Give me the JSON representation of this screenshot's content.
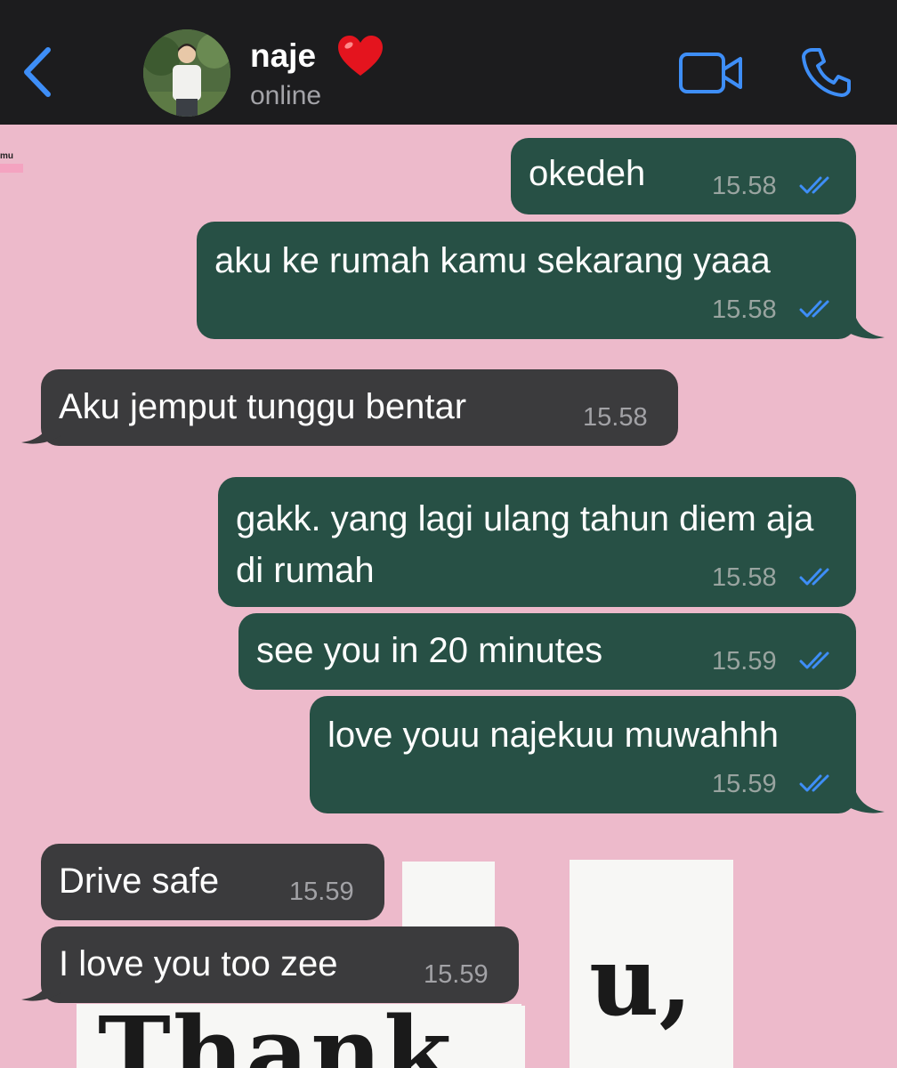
{
  "colors": {
    "outgoing_bubble": "#275045",
    "incoming_bubble": "#3b3b3d",
    "header_bg": "#1c1c1e",
    "wallpaper": "#edbacb",
    "accent": "#3e8ef7"
  },
  "header": {
    "name": "naje",
    "heart": "❤️",
    "status": "online",
    "icons": [
      "back-chevron-icon",
      "video-call-icon",
      "phone-call-icon"
    ]
  },
  "wallpaper": {
    "sticker_text": "mu",
    "deco_text": "Thank",
    "deco_u": "u,"
  },
  "messages": [
    {
      "direction": "out",
      "text": "okedeh",
      "time": "15.58",
      "read": true
    },
    {
      "direction": "out",
      "text": "aku ke rumah kamu sekarang yaaa",
      "time": "15.58",
      "read": true
    },
    {
      "direction": "in",
      "text": "Aku jemput tunggu bentar",
      "time": "15.58"
    },
    {
      "direction": "out",
      "text": "gakk. yang lagi ulang tahun diem aja di rumah",
      "time": "15.58",
      "read": true
    },
    {
      "direction": "out",
      "text": "see you in 20 minutes",
      "time": "15.59",
      "read": true
    },
    {
      "direction": "out",
      "text": "love youu najekuu muwahhh",
      "time": "15.59",
      "read": true
    },
    {
      "direction": "in",
      "text": "Drive safe",
      "time": "15.59"
    },
    {
      "direction": "in",
      "text": "I love you too zee",
      "time": "15.59"
    }
  ]
}
